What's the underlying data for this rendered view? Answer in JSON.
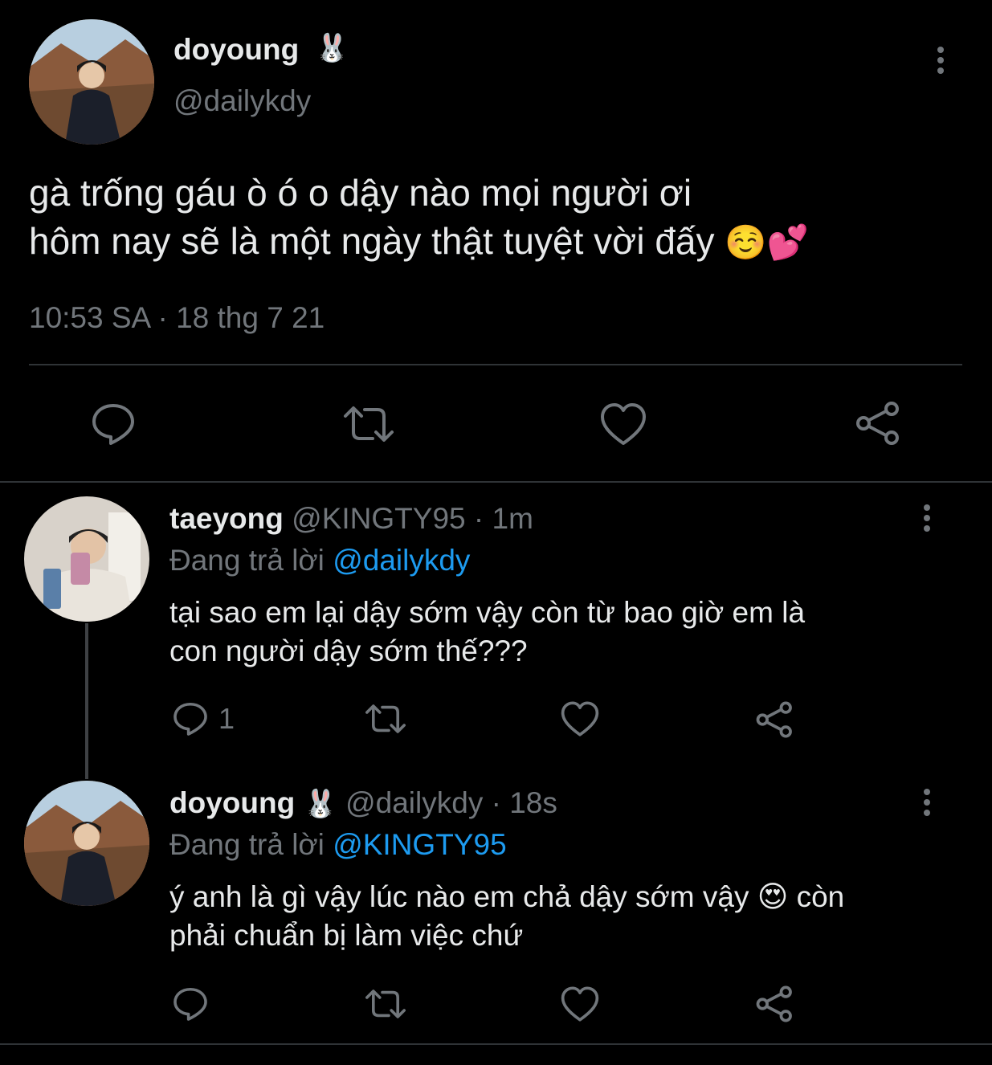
{
  "main_tweet": {
    "display_name": "doyoung",
    "name_emoji": "🐰",
    "handle": "@dailykdy",
    "text_line1": "gà trống gáu ò ó o dậy nào mọi người ơi",
    "text_line2": "hôm nay sẽ là một ngày thật tuyệt vời đấy",
    "text_emojis": "☺️💕",
    "timestamp": "10:53 SA · 18 thg 7 21",
    "actions": [
      "reply-icon",
      "retweet-icon",
      "like-icon",
      "share-icon"
    ]
  },
  "replies": [
    {
      "display_name": "taeyong",
      "name_emoji": "",
      "handle": "@KINGTY95",
      "age": "· 1m",
      "replying_prefix": "Đang trả lời",
      "replying_to": "@dailykdy",
      "text_line1": "tại sao em lại dậy sớm vậy còn từ bao giờ em là",
      "text_line2": "con người dậy sớm thế???",
      "reply_count": "1"
    },
    {
      "display_name": "doyoung",
      "name_emoji": "🐰",
      "handle": "@dailykdy",
      "age": "· 18s",
      "replying_prefix": "Đang trả lời",
      "replying_to": "@KINGTY95",
      "text_line1": "ý anh là gì vậy lúc nào em chả dậy sớm vậy",
      "text_emoji": "😍",
      "text_line1_end": "còn",
      "text_line2": "phải chuẩn bị làm việc chứ",
      "reply_count": ""
    }
  ],
  "colors": {
    "background": "#000000",
    "text": "#e7e9ea",
    "secondary": "#71767b",
    "link": "#1d9bf0",
    "divider": "#2f3336"
  }
}
